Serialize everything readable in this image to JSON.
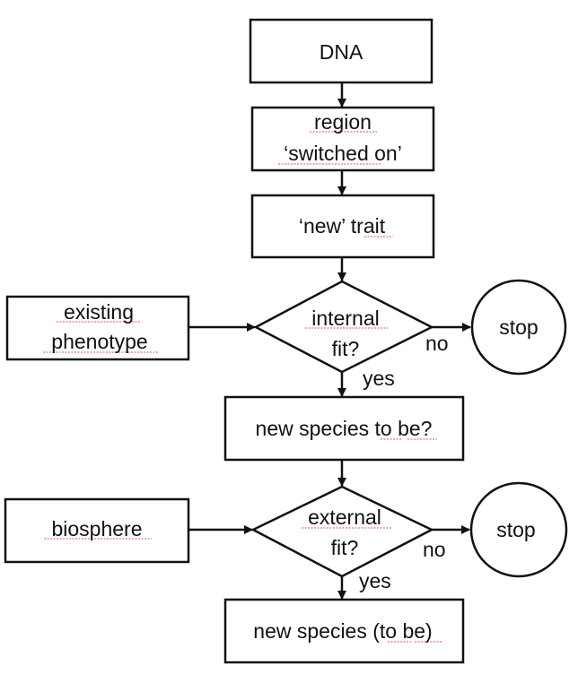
{
  "diagram": {
    "nodes": {
      "dna": {
        "type": "process",
        "lines": [
          "DNA"
        ]
      },
      "region": {
        "type": "process",
        "lines": [
          "region",
          "‘switched on’"
        ]
      },
      "trait": {
        "type": "process",
        "lines": [
          "‘new’ trait"
        ]
      },
      "existing_phenotype": {
        "type": "process",
        "lines": [
          "existing",
          "phenotype"
        ]
      },
      "internal_fit": {
        "type": "decision",
        "lines": [
          "internal",
          "fit?"
        ]
      },
      "stop1": {
        "type": "terminator",
        "lines": [
          "stop"
        ]
      },
      "species_q": {
        "type": "process",
        "lines": [
          "new species to be?"
        ]
      },
      "biosphere": {
        "type": "process",
        "lines": [
          "biosphere"
        ]
      },
      "external_fit": {
        "type": "decision",
        "lines": [
          "external",
          "fit?"
        ]
      },
      "stop2": {
        "type": "terminator",
        "lines": [
          "stop"
        ]
      },
      "species_final": {
        "type": "process",
        "lines": [
          "new species (to be)"
        ]
      }
    },
    "edges": [
      {
        "from": "dna",
        "to": "region",
        "label": ""
      },
      {
        "from": "region",
        "to": "trait",
        "label": ""
      },
      {
        "from": "trait",
        "to": "internal_fit",
        "label": ""
      },
      {
        "from": "existing_phenotype",
        "to": "internal_fit",
        "label": ""
      },
      {
        "from": "internal_fit",
        "to": "stop1",
        "label": "no"
      },
      {
        "from": "internal_fit",
        "to": "species_q",
        "label": "yes"
      },
      {
        "from": "species_q",
        "to": "external_fit",
        "label": ""
      },
      {
        "from": "biosphere",
        "to": "external_fit",
        "label": ""
      },
      {
        "from": "external_fit",
        "to": "stop2",
        "label": "no"
      },
      {
        "from": "external_fit",
        "to": "species_final",
        "label": "yes"
      }
    ],
    "edge_labels": {
      "internal_no": "no",
      "internal_yes": "yes",
      "external_no": "no",
      "external_yes": "yes"
    }
  }
}
